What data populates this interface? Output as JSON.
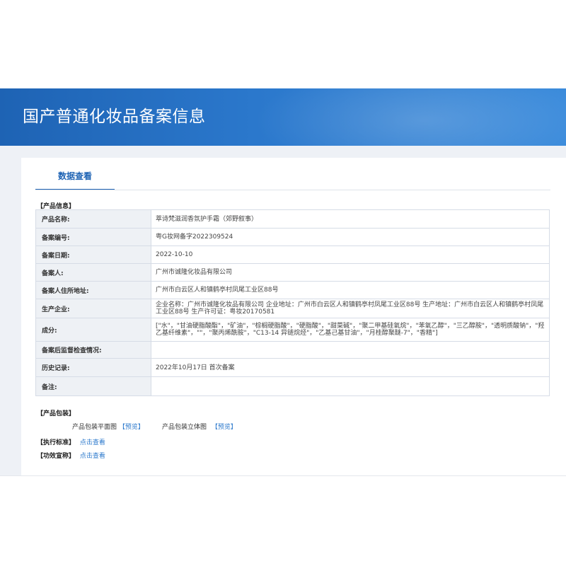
{
  "page": {
    "title": "国产普通化妆品备案信息"
  },
  "tab": {
    "label": "数据查看"
  },
  "product_info": {
    "section_label": "【产品信息】",
    "rows": [
      {
        "key": "产品名称:",
        "value": "萃诗梵滋润香氛护手霜（郊野叙事）"
      },
      {
        "key": "备案编号:",
        "value": "粤G妆网备字2022309524"
      },
      {
        "key": "备案日期:",
        "value": "2022-10-10"
      },
      {
        "key": "备案人:",
        "value": "广州市诚隆化妆品有限公司"
      },
      {
        "key": "备案人住所地址:",
        "value": "广州市白云区人和镇鹤亭村凤尾工业区88号"
      },
      {
        "key": "生产企业:",
        "value": "企业名称：广州市诚隆化妆品有限公司 企业地址：广州市白云区人和镇鹤亭村凤尾工业区88号 生产地址：广州市白云区人和镇鹤亭村凤尾工业区88号 生产许可证：粤妆20170581"
      },
      {
        "key": "成分:",
        "value": "[\"水\"，\"甘油硬脂酸酯\"，\"矿油\"，\"棕榈硬脂酸\"，\"硬脂酸\"，\"甜菜碱\"，\"聚二甲基硅氧烷\"，\"苯氧乙醇\"，\"三乙醇胺\"，\"透明质酸钠\"，\"羟乙基纤维素\"，\"\"，\"聚丙烯酰胺\"，\"C13-14 异链烷烃\"，\"乙基己基甘油\"，\"月桂醇聚醚-7\"，\"香精\"]"
      },
      {
        "key": "备案后监督检查情况:",
        "value": ""
      },
      {
        "key": "历史记录:",
        "value": "2022年10月17日 首次备案"
      },
      {
        "key": "备注:",
        "value": ""
      }
    ]
  },
  "packaging": {
    "section_label": "【产品包装】",
    "flat_label": "产品包装平面图",
    "flat_link": "【预览】",
    "solid_label": "产品包装立体图",
    "solid_link": "【预览】"
  },
  "standard": {
    "label": "【执行标准】",
    "link": "点击查看"
  },
  "efficacy": {
    "label": "【功效宣称】",
    "link": "点击查看"
  }
}
